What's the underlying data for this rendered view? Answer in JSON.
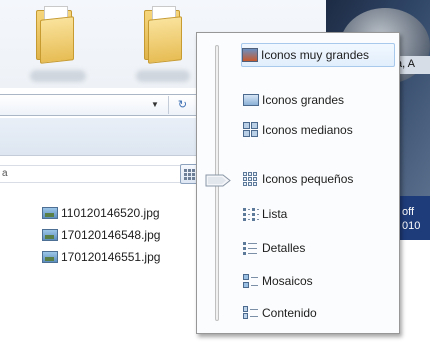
{
  "explorer": {
    "search_stub_text": "a",
    "files": [
      {
        "name": "110120146520.jpg"
      },
      {
        "name": "170120146548.jpg"
      },
      {
        "name": "170120146551.jpg"
      }
    ]
  },
  "desktop": {
    "window_title_fragment": "a, A",
    "partial_text_1": "off",
    "partial_text_2": "010"
  },
  "view_menu": {
    "items": [
      {
        "label": "Iconos muy grandes",
        "icon": "extra-large-icons-icon",
        "checked": true
      },
      {
        "label": "Iconos grandes",
        "icon": "large-icons-icon"
      },
      {
        "label": "Iconos medianos",
        "icon": "medium-icons-icon"
      },
      {
        "label": "Iconos pequeños",
        "icon": "small-icons-icon"
      },
      {
        "label": "Lista",
        "icon": "list-icon"
      },
      {
        "label": "Detalles",
        "icon": "details-icon"
      },
      {
        "label": "Mosaicos",
        "icon": "tiles-icon"
      },
      {
        "label": "Contenido",
        "icon": "content-icon"
      }
    ],
    "slider_position_label": "Iconos pequeños"
  },
  "colors": {
    "menu_highlight": "#e1eefc",
    "menu_border": "#979797"
  }
}
